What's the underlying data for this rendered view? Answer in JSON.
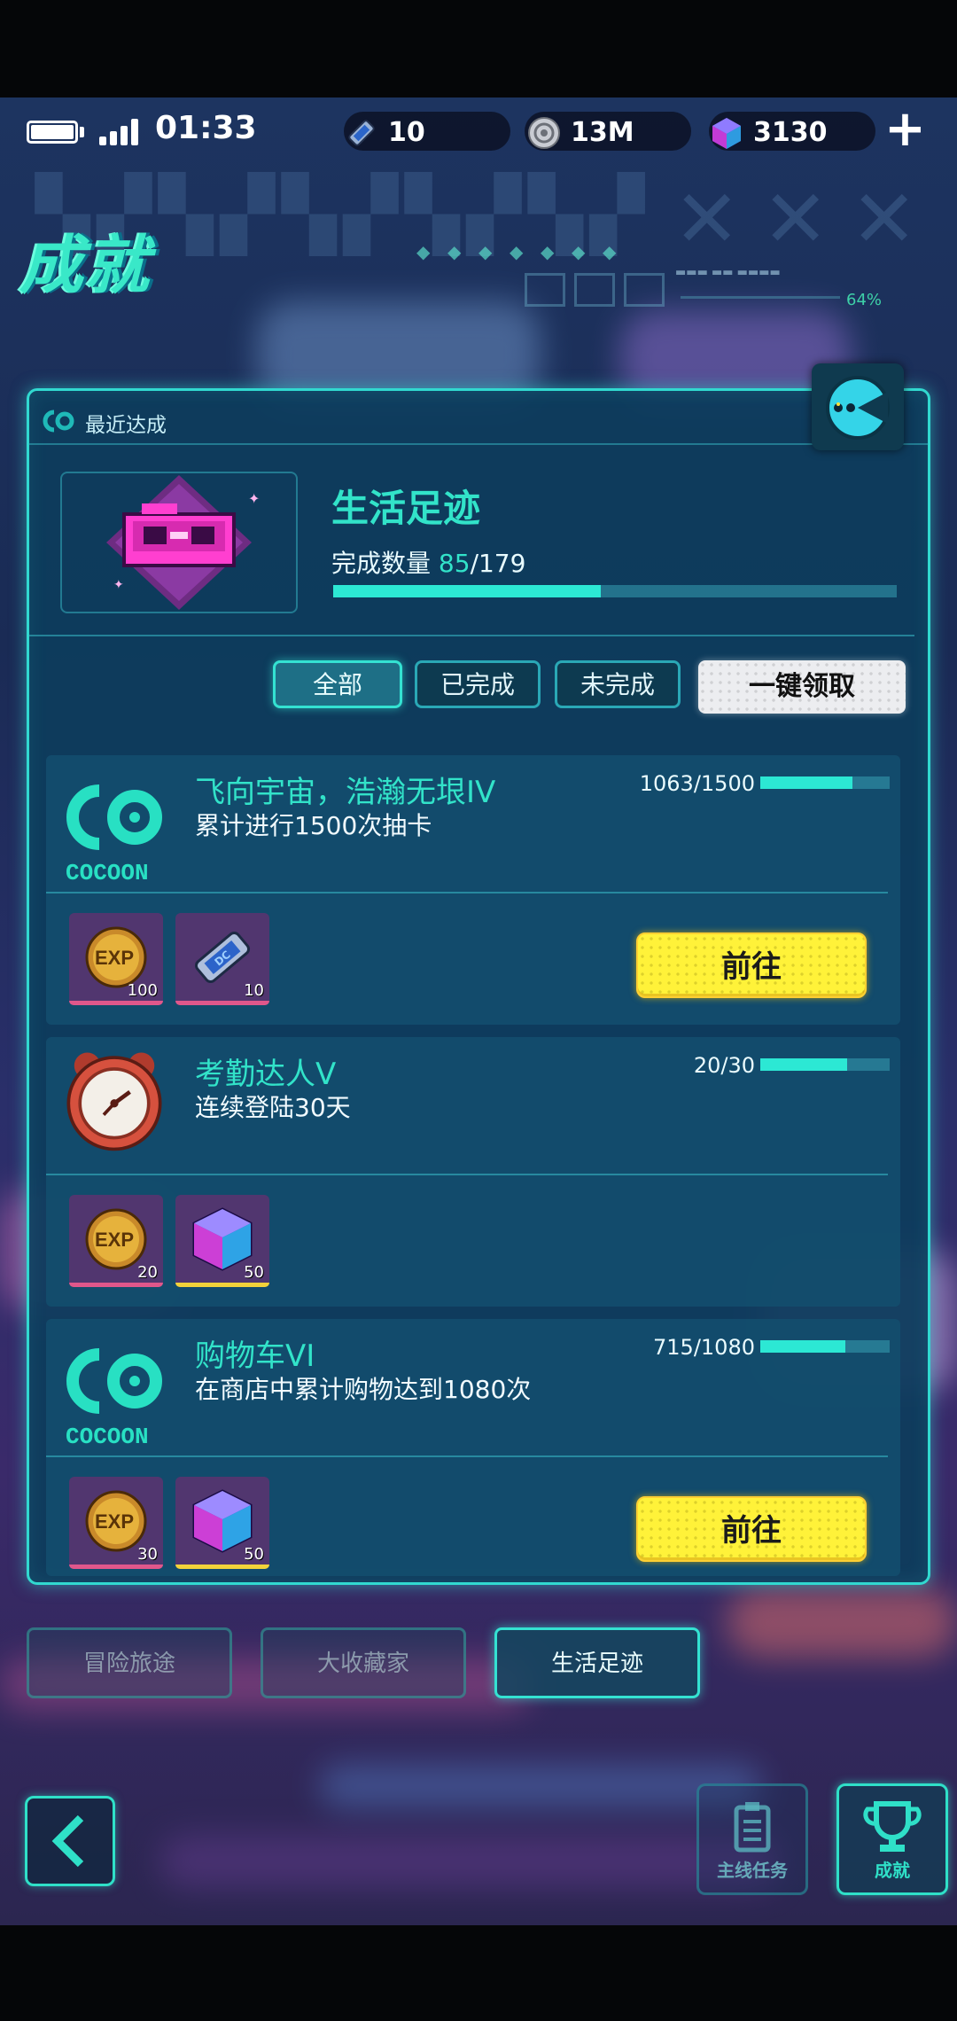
{
  "status_bar": {
    "time": "01:33",
    "resources": [
      {
        "icon": "ticket-icon",
        "value": "10"
      },
      {
        "icon": "coin-disc-icon",
        "value": "13M"
      },
      {
        "icon": "crystal-cube-icon",
        "value": "3130"
      }
    ],
    "add_label": "+"
  },
  "header": {
    "title": "成就",
    "progress_text": "64%"
  },
  "recent": {
    "label": "最近达成",
    "category_title": "生活足迹",
    "count_label": "完成数量",
    "count_done": "85",
    "count_total": "/179",
    "progress_fraction": 0.475
  },
  "filters": {
    "all": "全部",
    "completed": "已完成",
    "incomplete": "未完成",
    "claim_all": "一键领取"
  },
  "achievements": [
    {
      "title": "飞向宇宙，浩瀚无垠IV",
      "desc": "累计进行1500次抽卡",
      "progress": "1063/1500",
      "fraction": 0.71,
      "icon": "cocoon-logo-icon",
      "rewards": [
        {
          "icon": "exp-coin-icon",
          "qty": "100",
          "rarity_color": "#e0578b"
        },
        {
          "icon": "ticket-icon",
          "qty": "10",
          "rarity_color": "#e0578b"
        }
      ],
      "action": "前往"
    },
    {
      "title": "考勤达人V",
      "desc": "连续登陆30天",
      "progress": "20/30",
      "fraction": 0.67,
      "icon": "alarm-clock-icon",
      "rewards": [
        {
          "icon": "exp-coin-icon",
          "qty": "20",
          "rarity_color": "#e0578b"
        },
        {
          "icon": "crystal-cube-icon",
          "qty": "50",
          "rarity_color": "#f2d23a"
        }
      ],
      "action": ""
    },
    {
      "title": "购物车VI",
      "desc": "在商店中累计购物达到1080次",
      "progress": "715/1080",
      "fraction": 0.66,
      "icon": "cocoon-logo-icon",
      "rewards": [
        {
          "icon": "exp-coin-icon",
          "qty": "30",
          "rarity_color": "#e0578b"
        },
        {
          "icon": "crystal-cube-icon",
          "qty": "50",
          "rarity_color": "#f2d23a"
        }
      ],
      "action": "前往"
    }
  ],
  "cocoon_text": "COCOON",
  "category_tabs": [
    "冒险旅途",
    "大收藏家",
    "生活足迹"
  ],
  "bottom_nav": {
    "main_quest": "主线任务",
    "achievement": "成就"
  }
}
